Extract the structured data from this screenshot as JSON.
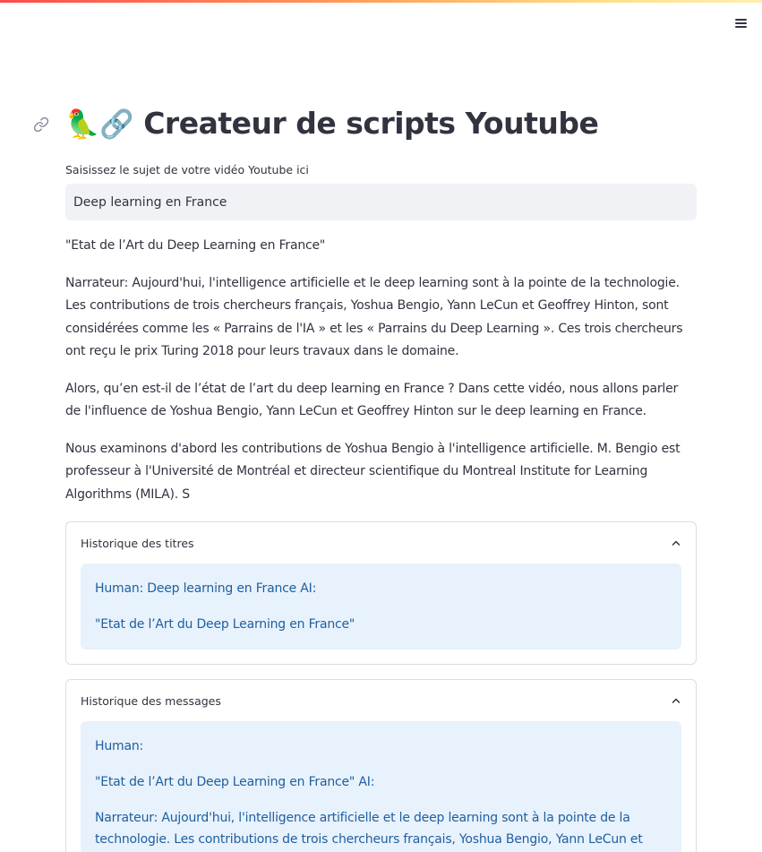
{
  "header": {
    "menu_icon": "hamburger-menu-icon"
  },
  "title": {
    "emoji": "🦜🔗",
    "text": "Createur de scripts Youtube",
    "anchor_icon": "link-icon"
  },
  "topic_input": {
    "label": "Saisissez le sujet de votre vidéo Youtube ici",
    "value": "Deep learning en France"
  },
  "output": {
    "title_line": "\"Etat de l’Art du Deep Learning en France\"",
    "paragraphs": [
      "Narrateur: Aujourd'hui, l'intelligence artificielle et le deep learning sont à la pointe de la technologie. Les contributions de trois chercheurs français, Yoshua Bengio, Yann LeCun et Geoffrey Hinton, sont considérées comme les « Parrains de l'IA » et les « Parrains du Deep Learning ». Ces trois chercheurs ont reçu le prix Turing 2018 pour leurs travaux dans le domaine.",
      "Alors, qu’en est-il de l’état de l’art du deep learning en France ? Dans cette vidéo, nous allons parler de l'influence de Yoshua Bengio, Yann LeCun et Geoffrey Hinton sur le deep learning en France.",
      "Nous examinons d'abord les contributions de Yoshua Bengio à l'intelligence artificielle. M. Bengio est professeur à l'Université de Montréal et directeur scientifique du Montreal Institute for Learning Algorithms (MILA). S"
    ]
  },
  "title_history": {
    "label": "Historique des titres",
    "chevron_icon": "chevron-up-icon",
    "lines": [
      "Human: Deep learning en France AI:",
      "\"Etat de l’Art du Deep Learning en France\""
    ]
  },
  "message_history": {
    "label": "Historique des messages",
    "chevron_icon": "chevron-up-icon",
    "lines": [
      "Human:",
      "\"Etat de l’Art du Deep Learning en France\" AI:",
      "Narrateur: Aujourd'hui, l'intelligence artificielle et le deep learning sont à la pointe de la technologie. Les contributions de trois chercheurs français, Yoshua Bengio, Yann LeCun et"
    ]
  }
}
